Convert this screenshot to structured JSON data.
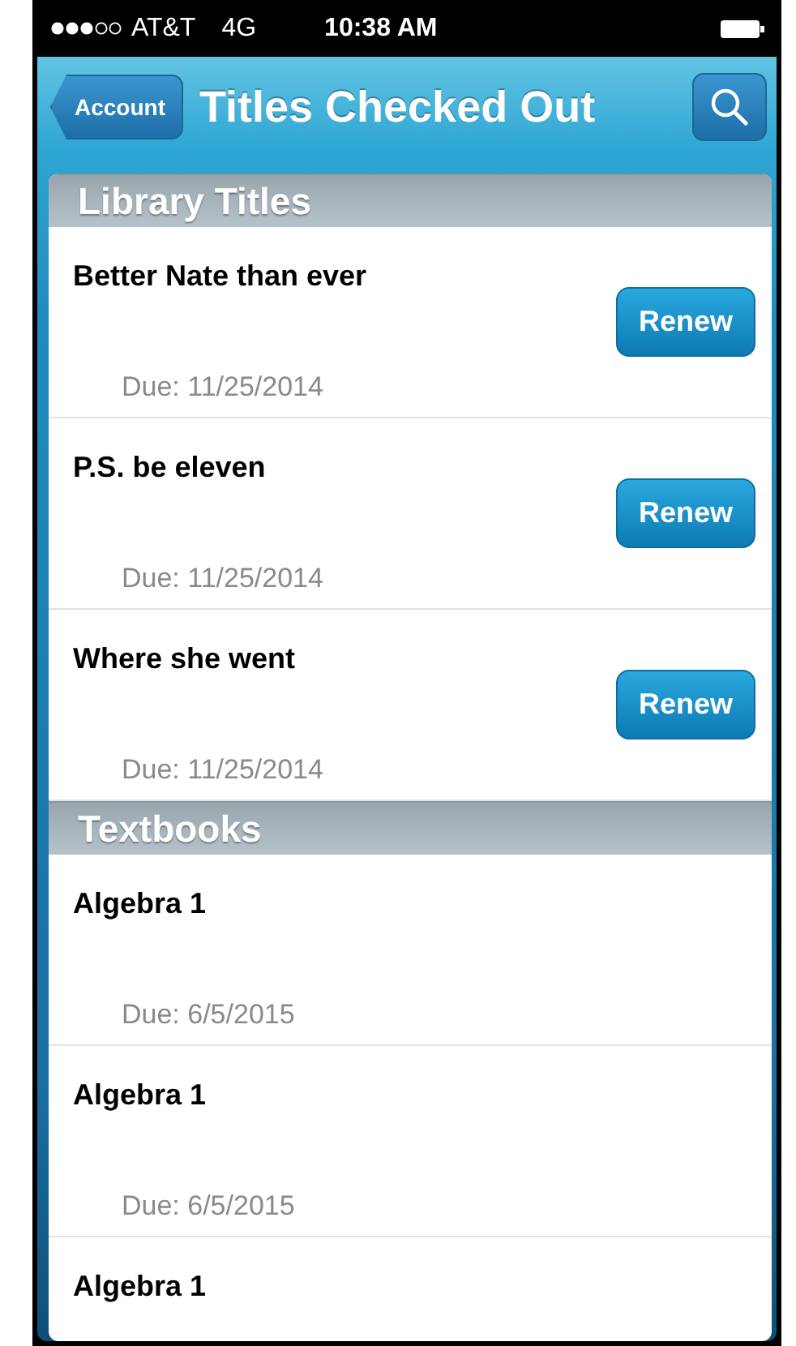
{
  "status_bar": {
    "carrier": "AT&T",
    "network": "4G",
    "time": "10:38 AM"
  },
  "nav_bar": {
    "back_button": "Account",
    "title": "Titles Checked Out"
  },
  "sections": [
    {
      "title": "Library Titles",
      "items": [
        {
          "title": "Better Nate than ever",
          "due": "Due: 11/25/2014",
          "action": "Renew"
        },
        {
          "title": "P.S. be eleven",
          "due": "Due: 11/25/2014",
          "action": "Renew"
        },
        {
          "title": "Where she went",
          "due": "Due: 11/25/2014",
          "action": "Renew"
        }
      ]
    },
    {
      "title": "Textbooks",
      "items": [
        {
          "title": "Algebra 1",
          "due": "Due: 6/5/2015"
        },
        {
          "title": "Algebra 1",
          "due": "Due: 6/5/2015"
        },
        {
          "title": "Algebra 1"
        }
      ]
    }
  ]
}
